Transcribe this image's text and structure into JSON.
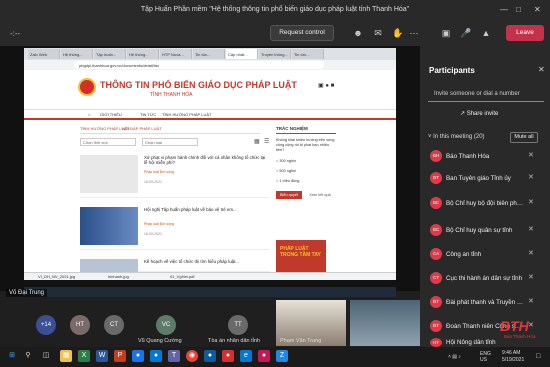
{
  "window": {
    "title": "Tập Huấn Phần mềm \"Hệ thống thông tin phổ biến giáo dục pháp luật tỉnh Thanh Hóa\"",
    "controls": [
      "—",
      "□",
      "✕"
    ]
  },
  "meeting_toolbar": {
    "timer": "-:--",
    "request_control": "Request control",
    "leave": "Leave"
  },
  "browser": {
    "tabs": [
      "Zalo Web",
      "Hệ thống...",
      "Tập huấn...",
      "Hệ thống...",
      "HTP Nova...",
      "Tin tức...",
      "Cập nhật...",
      "Truyền thông...",
      "Tin tức..."
    ],
    "url": "pbgdpl.thanhhoa.gov.vn/documents/detail/list"
  },
  "site": {
    "title": "THÔNG TIN PHỔ BIẾN GIÁO DỤC PHÁP LUẬT",
    "subtitle": "TỈNH THANH HÓA",
    "nav": [
      "GIỚI THIỆU",
      "TIN TỨC",
      "TÌNH HƯỚNG PHÁP LUẬT"
    ],
    "content_tabs": [
      "TÌNH HƯỚNG PHÁP LUẬT",
      "HỎI ĐÁP PHÁP LUẬT"
    ],
    "filters": [
      "Chọn lĩnh vực",
      "Chọn loại"
    ],
    "articles": [
      {
        "title": "Xử phạt vi phạm hành chính đối với cá nhân không tổ chức tại lễ hội miễn phí?",
        "meta": "Pháp luật Đời sống",
        "date": "16-09-2021"
      },
      {
        "title": "Hội nghị Tập huấn pháp luật về bảo vệ trẻ em...",
        "meta": "Pháp luật Đời sống",
        "date": "16-09-2021"
      },
      {
        "title": "Kế hoạch về việc tổ chức thi tìm hiểu pháp luật...",
        "meta": "",
        "date": ""
      }
    ],
    "survey": {
      "heading": "TRẮC NGHIỆM",
      "question": "Không khai khiêu hướng trên vùng công cộng rồi bị phạt bao nhiêu tiền?",
      "options": [
        "300 nghìn",
        "500 nghìn",
        "1 triệu đồng"
      ],
      "submit": "Biểu quyết",
      "results": "Xem kết quả"
    },
    "promo": "PHÁP LUẬT TRONG TẦM TAY"
  },
  "downloads": [
    "VI_DH_NV_2021.jpg",
    "hinhanh.jpg",
    "01_VgHet.pdf"
  ],
  "presenter": "Võ Đại Trung",
  "participants_strip": [
    {
      "initials": "+14",
      "color": "#3b4f96"
    },
    {
      "initials": "HT",
      "color": "#7a6a6a"
    },
    {
      "initials": "CT",
      "color": "#6a6a6a"
    },
    {
      "initials": "VC",
      "color": "#5d7a6a",
      "name": "Vũ Quang Cường"
    },
    {
      "initials": "TT",
      "color": "#6a6a6a",
      "name": "Tòa án nhân dân tỉnh"
    },
    {
      "name": "Phạm Văn Trung"
    }
  ],
  "panel": {
    "title": "Participants",
    "invite_placeholder": "Invite someone or dial a number",
    "share_invite": "Share invite",
    "in_meeting": "In this meeting (20)",
    "mute_all": "Mute all",
    "people": [
      {
        "initials": "BH",
        "name": "Báo Thanh Hóa"
      },
      {
        "initials": "BT",
        "name": "Ban Tuyên giáo Tỉnh ủy"
      },
      {
        "initials": "BC",
        "name": "Bộ Chỉ huy bộ đội biên phòn..."
      },
      {
        "initials": "BC",
        "name": "Bộ Chỉ huy quân sự tỉnh"
      },
      {
        "initials": "CA",
        "name": "Công an tỉnh"
      },
      {
        "initials": "CT",
        "name": "Cục thi hành án dân sự tỉnh"
      },
      {
        "initials": "ĐT",
        "name": "Đài phát thanh và Truyền hìn..."
      },
      {
        "initials": "ĐT",
        "name": "Đoàn Thanh niên Cộng sản H..."
      },
      {
        "initials": "HT",
        "name": "Hội Nông dân tỉnh"
      }
    ]
  },
  "taskbar": {
    "tray_lang": "ENG US",
    "clock": "9:46 AM",
    "date": "5/19/2021"
  },
  "watermark": {
    "logo": "BTH",
    "caption": "Báo Thanh Hóa"
  }
}
